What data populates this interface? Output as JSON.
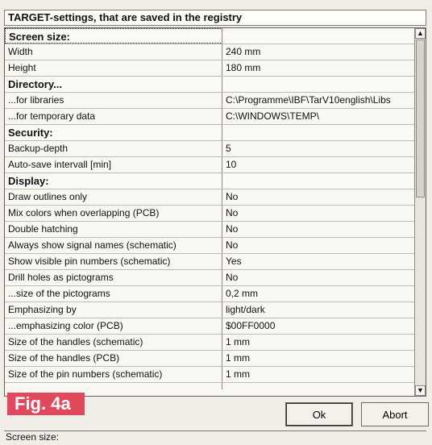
{
  "window": {
    "title": "TARGET-settings, that are saved in the registry"
  },
  "grid": {
    "rows": [
      {
        "label": "Screen size:",
        "value": "",
        "type": "section",
        "selected": true
      },
      {
        "label": "Width",
        "value": "240 mm",
        "type": "item"
      },
      {
        "label": "Height",
        "value": "180 mm",
        "type": "item"
      },
      {
        "label": "Directory...",
        "value": "",
        "type": "section"
      },
      {
        "label": "...for libraries",
        "value": "C:\\Programme\\IBF\\TarV10english\\Libs",
        "type": "item"
      },
      {
        "label": "...for temporary data",
        "value": "C:\\WINDOWS\\TEMP\\",
        "type": "item"
      },
      {
        "label": "Security:",
        "value": "",
        "type": "section"
      },
      {
        "label": "Backup-depth",
        "value": "5",
        "type": "item"
      },
      {
        "label": "Auto-save intervall [min]",
        "value": "10",
        "type": "item"
      },
      {
        "label": "Display:",
        "value": "",
        "type": "section"
      },
      {
        "label": "Draw outlines only",
        "value": "No",
        "type": "item"
      },
      {
        "label": "Mix colors when overlapping (PCB)",
        "value": "No",
        "type": "item"
      },
      {
        "label": "Double hatching",
        "value": "No",
        "type": "item"
      },
      {
        "label": "Always show signal names (schematic)",
        "value": "No",
        "type": "item"
      },
      {
        "label": "Show visible pin numbers (schematic)",
        "value": "Yes",
        "type": "item"
      },
      {
        "label": "Drill holes as pictograms",
        "value": "No",
        "type": "item"
      },
      {
        "label": "...size of the pictograms",
        "value": "0,2 mm",
        "type": "item"
      },
      {
        "label": "Emphasizing by",
        "value": "light/dark",
        "type": "item"
      },
      {
        "label": "...emphasizing color (PCB)",
        "value": "$00FF0000",
        "type": "item"
      },
      {
        "label": "Size of the handles (schematic)",
        "value": "1 mm",
        "type": "item"
      },
      {
        "label": "Size of the handles (PCB)",
        "value": "1 mm",
        "type": "item"
      },
      {
        "label": "Size of the pin numbers (schematic)",
        "value": "1 mm",
        "type": "item"
      }
    ]
  },
  "figure": {
    "label": "Fig. 4a"
  },
  "buttons": {
    "ok": "Ok",
    "abort": "Abort"
  },
  "status": {
    "text": "Screen size:"
  },
  "icons": {
    "scroll_up": "triangle-up-icon",
    "scroll_down": "triangle-down-icon"
  },
  "colors": {
    "figure_label_bg": "#e2495c"
  }
}
